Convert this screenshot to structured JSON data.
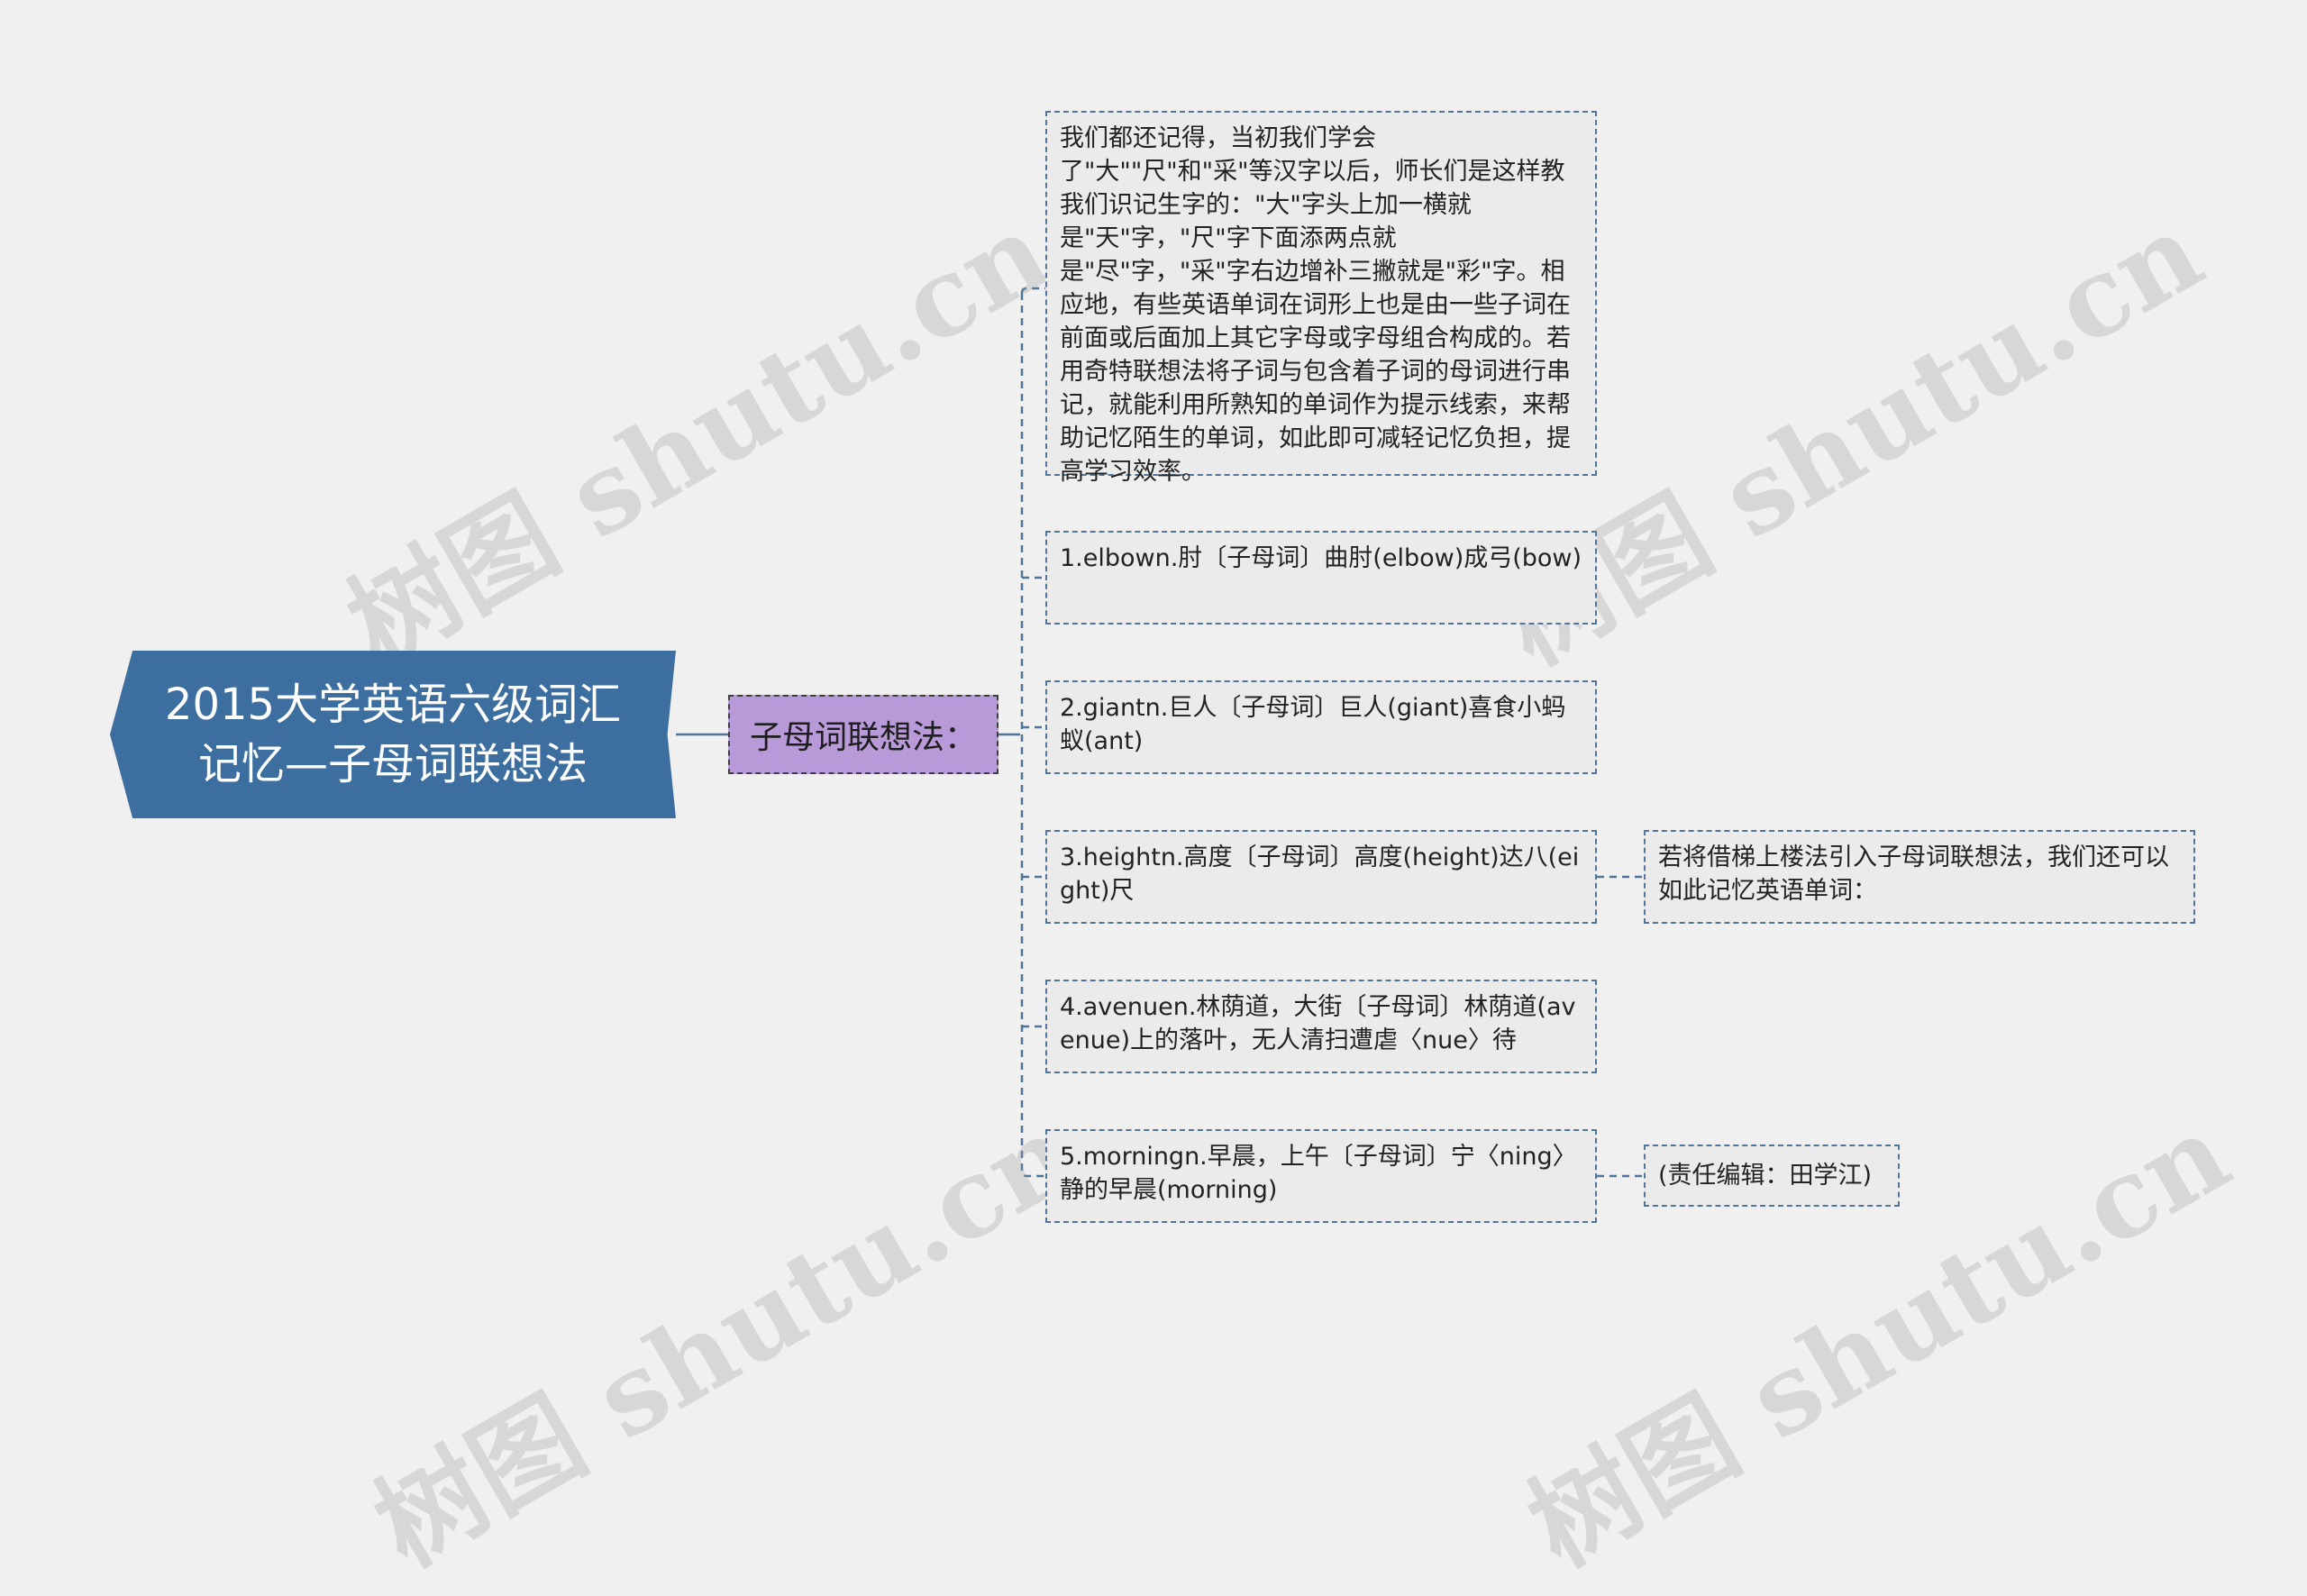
{
  "watermark": "树图 shutu.cn",
  "colors": {
    "background": "#f0f0f0",
    "root_fill": "#3c6e9f",
    "sub_fill": "#b99ad9",
    "leaf_fill": "#ebebeb",
    "connector": "#51759a"
  },
  "root": {
    "title": "2015大学英语六级词汇记忆—子母词联想法"
  },
  "branch": {
    "label": "子母词联想法："
  },
  "leaves": [
    {
      "text": "我们都还记得，当初我们学会了\"大\"\"尺\"和\"采\"等汉字以后，师长们是这样教我们识记生字的：\"大\"字头上加一横就是\"天\"字，\"尺\"字下面添两点就是\"尽\"字，\"采\"字右边增补三撇就是\"彩\"字。相应地，有些英语单词在词形上也是由一些子词在前面或后面加上其它字母或字母组合构成的。若用奇特联想法将子词与包含着子词的母词进行串记，就能利用所熟知的单词作为提示线索，来帮助记忆陌生的单词，如此即可减轻记忆负担，提高学习效率。"
    },
    {
      "text": "1.elbown.肘〔子母词〕曲肘(elbow)成弓(bow)"
    },
    {
      "text": "2.giantn.巨人〔子母词〕巨人(giant)喜食小蚂蚁(ant)"
    },
    {
      "text": "3.heightn.高度〔子母词〕高度(height)达八(eight)尺"
    },
    {
      "text": "4.avenuen.林荫道，大街〔子母词〕林荫道(avenue)上的落叶，无人清扫遭虐〈nue〉待"
    },
    {
      "text": "5.morningn.早晨，上午〔子母词〕宁〈ning〉静的早晨(morning)"
    }
  ],
  "extras": [
    {
      "text": "若将借梯上楼法引入子母词联想法，我们还可以如此记忆英语单词："
    },
    {
      "text": "(责任编辑：田学江)"
    }
  ]
}
